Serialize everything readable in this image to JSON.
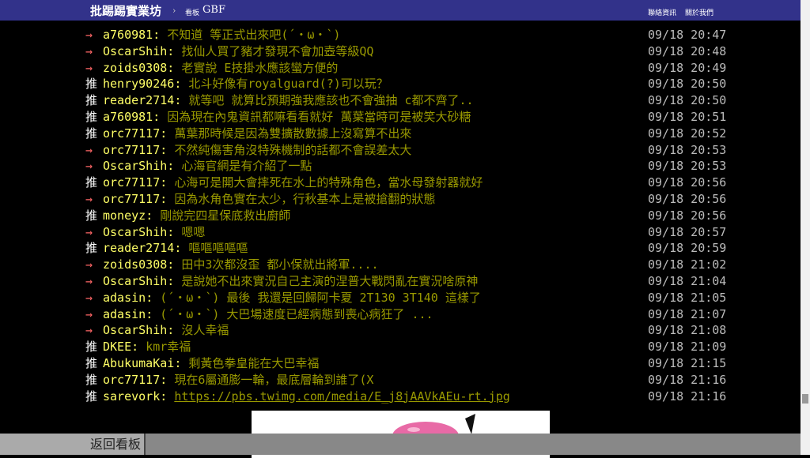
{
  "header": {
    "brand": "批踢踢實業坊",
    "separator": "›",
    "board_prefix": "看板",
    "board_name": "GBF",
    "links": [
      "聯絡資訊",
      "關於我們"
    ]
  },
  "comments": [
    {
      "tag": "→",
      "user": "a760981",
      "msg": "不知道 等正式出來吧(´・ω・`)",
      "time": "09/18 20:47"
    },
    {
      "tag": "→",
      "user": "OscarShih",
      "msg": "找仙人買了豬才發現不會加壺等級QQ",
      "time": "09/18 20:48"
    },
    {
      "tag": "→",
      "user": "zoids0308",
      "msg": "老實說 E技掛水應該蠻方便的",
      "time": "09/18 20:49"
    },
    {
      "tag": "推",
      "user": "henry90246",
      "msg": "北斗好像有royalguard(?)可以玩？",
      "time": "09/18 20:50"
    },
    {
      "tag": "推",
      "user": "reader2714",
      "msg": "就等吧 就算比預期強我應該也不會強抽 c都不齊了..",
      "time": "09/18 20:50"
    },
    {
      "tag": "推",
      "user": "a760981",
      "msg": "因為現在內鬼資訊都嘛看看就好 萬葉當時可是被笑大砂糖",
      "time": "09/18 20:51"
    },
    {
      "tag": "推",
      "user": "orc77117",
      "msg": "萬葉那時候是因為雙擴散數據上沒寫算不出來",
      "time": "09/18 20:52"
    },
    {
      "tag": "→",
      "user": "orc77117",
      "msg": "不然純傷害角沒特殊機制的話都不會誤差太大",
      "time": "09/18 20:53"
    },
    {
      "tag": "→",
      "user": "OscarShih",
      "msg": "心海官網是有介紹了一點",
      "time": "09/18 20:53"
    },
    {
      "tag": "推",
      "user": "orc77117",
      "msg": "心海可是開大會摔死在水上的特殊角色，當水母發射器就好",
      "time": "09/18 20:56"
    },
    {
      "tag": "→",
      "user": "orc77117",
      "msg": "因為水角色實在太少，行秋基本上是被搶翻的狀態",
      "time": "09/18 20:56"
    },
    {
      "tag": "推",
      "user": "moneyz",
      "msg": "剛說完四星保底救出廚師",
      "time": "09/18 20:56"
    },
    {
      "tag": "→",
      "user": "OscarShih",
      "msg": "嗯嗯",
      "time": "09/18 20:57"
    },
    {
      "tag": "推",
      "user": "reader2714",
      "msg": "嘔嘔嘔嘔嘔",
      "time": "09/18 20:59"
    },
    {
      "tag": "→",
      "user": "zoids0308",
      "msg": "田中3次都沒歪 都小保就出將軍....",
      "time": "09/18 21:02"
    },
    {
      "tag": "→",
      "user": "OscarShih",
      "msg": "是說她不出來實況自己主演的涅普大戰閃亂在實況啥原神",
      "time": "09/18 21:04"
    },
    {
      "tag": "→",
      "user": "adasin",
      "msg": "(´・ω・`) 最後 我還是回歸阿卡夏 2T130 3T140 這樣了",
      "time": "09/18 21:05"
    },
    {
      "tag": "→",
      "user": "adasin",
      "msg": "(´・ω・`) 大巴場速度已經病態到喪心病狂了 ...",
      "time": "09/18 21:07"
    },
    {
      "tag": "→",
      "user": "OscarShih",
      "msg": "沒人幸福",
      "time": "09/18 21:08"
    },
    {
      "tag": "推",
      "user": "DKEE",
      "msg": "kmr幸福",
      "time": "09/18 21:09"
    },
    {
      "tag": "推",
      "user": "AbukumaKai",
      "msg": "剩黃色拳皇能在大巴幸福",
      "time": "09/18 21:15"
    },
    {
      "tag": "推",
      "user": "orc77117",
      "msg": "現在6屬通膨一輪，最底層輪到誰了(X",
      "time": "09/18 21:16"
    },
    {
      "tag": "推",
      "user": "sarevork",
      "msg": "https://pbs.twimg.com/media/E_j8jAAVkAEu-rt.jpg",
      "time": "09/18 21:16",
      "link": true
    }
  ],
  "footer": {
    "back_label": "返回看板"
  }
}
